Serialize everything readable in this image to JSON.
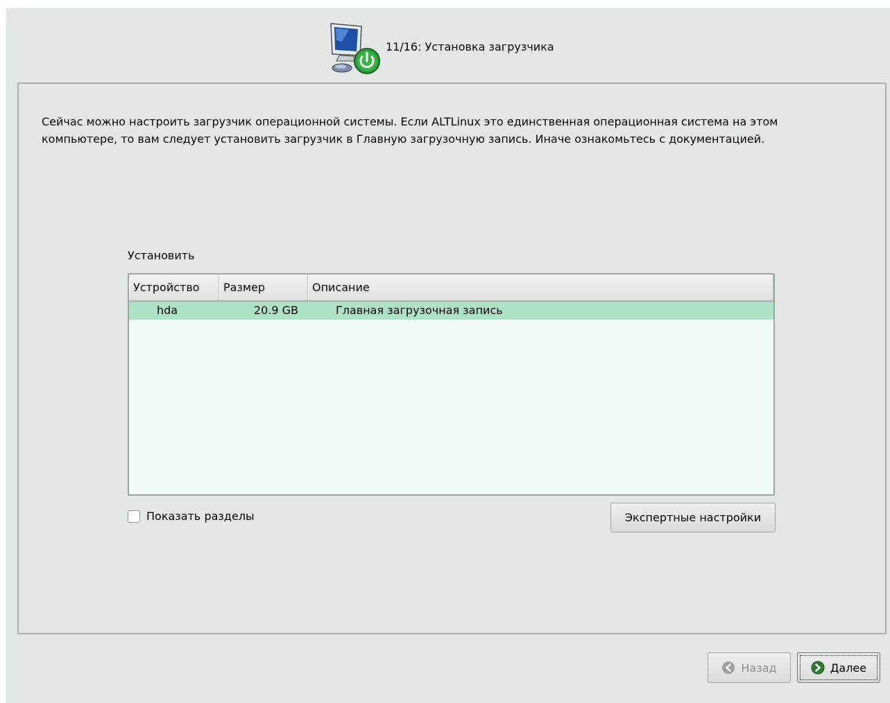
{
  "header": {
    "title": "11/16: Установка загрузчика",
    "icon": "computer-power-icon"
  },
  "description": "Сейчас можно настроить загрузчик операционной системы. Если ALTLinux это единственная операционная система на этом компьютере, то вам следует установить загрузчик в Главную загрузочную запись. Иначе ознакомьтесь с документацией.",
  "install": {
    "label": "Установить",
    "columns": [
      "Устройство",
      "Размер",
      "Описание"
    ],
    "rows": [
      {
        "device": "hda",
        "size": "20.9 GB",
        "description": "Главная загрузочная запись",
        "selected": true
      }
    ]
  },
  "show_partitions": {
    "label": "Показать разделы",
    "checked": false
  },
  "expert_button": {
    "label": "Экспертные настройки"
  },
  "navigation": {
    "back_label": "Назад",
    "back_enabled": false,
    "next_label": "Далее"
  },
  "colors": {
    "background": "#e3e7e6",
    "selected_row": "#aee2c7",
    "table_bg": "#f3fbf7",
    "next_icon": "#2e7d32"
  }
}
